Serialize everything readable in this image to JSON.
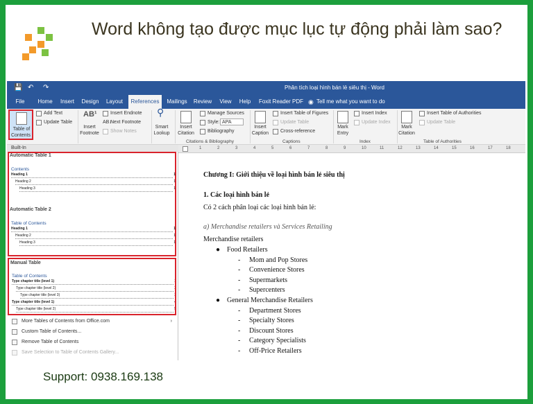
{
  "headline": "Word không tạo được mục lục tự động phải làm sao?",
  "support": "Support: 0938.169.138",
  "colors": {
    "border_green": "#1c9f3c",
    "word_blue": "#2b579a",
    "highlight_red": "#d9232c",
    "logo_orange": "#f39a2a",
    "logo_green": "#7cc242"
  },
  "word": {
    "doc_title": "Phân tích loại hình bán lẻ siêu thị  -  Word",
    "tabs": [
      "File",
      "Home",
      "Insert",
      "Design",
      "Layout",
      "References",
      "Mailings",
      "Review",
      "View",
      "Help",
      "Foxit Reader PDF"
    ],
    "active_tab": "References",
    "tell_me": "Tell me what you want to do",
    "ribbon": {
      "toc_button": [
        "Table of",
        "Contents"
      ],
      "add_text": "Add Text",
      "update_table": "Update Table",
      "insert_footnote": [
        "Insert",
        "Footnote"
      ],
      "insert_endnote": "Insert Endnote",
      "next_footnote": "Next Footnote",
      "show_notes": "Show Notes",
      "smart_lookup": [
        "Smart",
        "Lookup"
      ],
      "insert_citation": [
        "Insert",
        "Citation"
      ],
      "manage_sources": "Manage Sources",
      "style_label": "Style:",
      "style_value": "APA",
      "bibliography": "Bibliography",
      "insert_caption": [
        "Insert",
        "Caption"
      ],
      "insert_table_of_figures": "Insert Table of Figures",
      "update_table_dim": "Update Table",
      "cross_reference": "Cross-reference",
      "mark_entry": [
        "Mark",
        "Entry"
      ],
      "insert_index": "Insert Index",
      "update_index": "Update Index",
      "mark_citation": [
        "Mark",
        "Citation"
      ],
      "insert_table_of_authorities": "Insert Table of Authorities",
      "update_table_auth": "Update Table",
      "groups": [
        "Citations & Bibliography",
        "Captions",
        "Index",
        "Table of Authorities"
      ]
    },
    "gallery": {
      "builtin_label": "Built-In",
      "auto1": {
        "title": "Automatic Table 1",
        "heading": "Contents",
        "lines": [
          "Heading 1",
          "Heading 2",
          "Heading 3"
        ],
        "pages": [
          "1",
          "1",
          "1"
        ]
      },
      "auto2": {
        "title": "Automatic Table 2",
        "heading": "Table of Contents",
        "lines": [
          "Heading 1",
          "Heading 2",
          "Heading 3"
        ],
        "pages": [
          "1",
          "1",
          "1"
        ]
      },
      "manual": {
        "title": "Manual Table",
        "heading": "Table of Contents",
        "lines": [
          "Type chapter title (level 1)",
          "Type chapter title (level 2)",
          "Type chapter title (level 3)",
          "Type chapter title (level 1)",
          "Type chapter title (level 2)"
        ],
        "pages": [
          "1",
          "2",
          "3",
          "4",
          "5"
        ]
      },
      "menu": [
        "More Tables of Contents from Office.com",
        "Custom Table of Contents...",
        "Remove Table of Contents",
        "Save Selection to Table of Contents Gallery..."
      ]
    },
    "ruler_ticks": [
      "1",
      "2",
      "3",
      "4",
      "5",
      "6",
      "7",
      "8",
      "9",
      "10",
      "11",
      "12",
      "13",
      "14",
      "15",
      "16",
      "17",
      "18"
    ],
    "document": {
      "chapter": "Chương I: Giới thiệu về loại hình bán lẻ siêu thị",
      "section": "1. Các loại hình bán lẻ",
      "intro": "Có 2 cách phân loại các loại hình bán lẻ:",
      "subsection": "a) Merchandise retailers và Services Retailing",
      "merchandise": "Merchandise retailers",
      "food": "Food Retailers",
      "food_items": [
        "Mom and Pop Stores",
        "Convenience Stores",
        "Supermarkets",
        "Supercenters"
      ],
      "general": "General Merchandise Retailers",
      "general_items": [
        "Department Stores",
        "Specialty Stores",
        "Discount Stores",
        "Category Specialists",
        "Off-Price Retailers"
      ]
    }
  }
}
